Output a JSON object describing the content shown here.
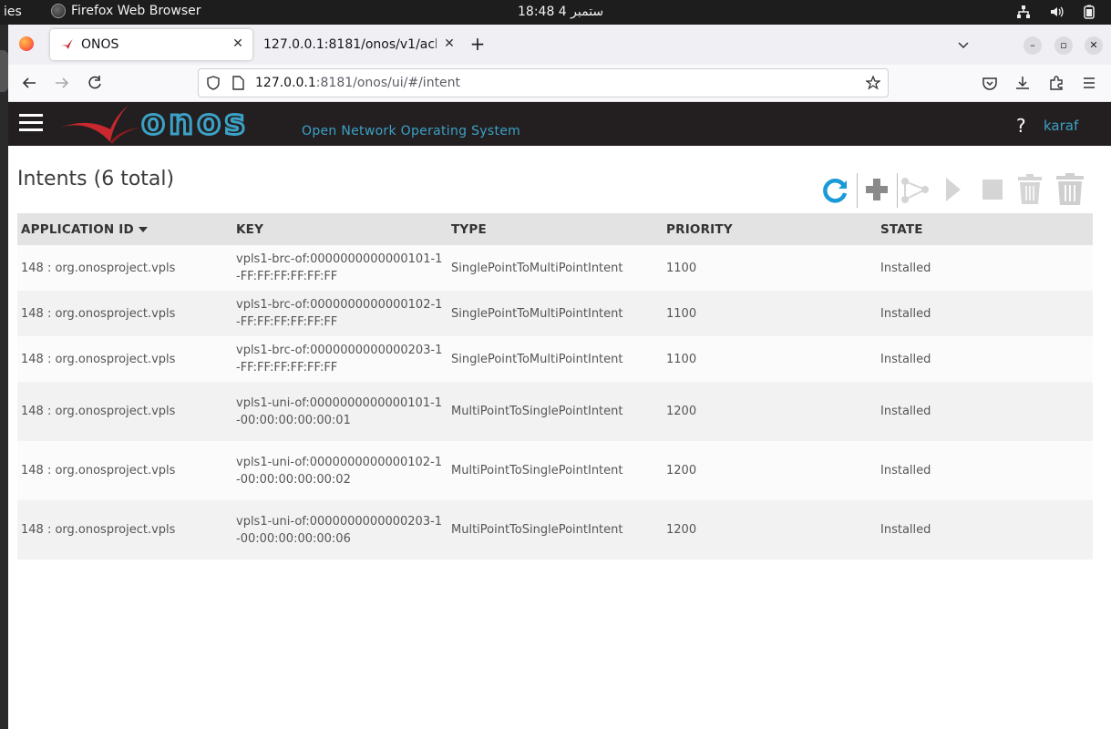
{
  "os": {
    "activities": "ies",
    "app_name": "Firefox Web Browser",
    "clock": "18:48  4 ستمبر"
  },
  "browser": {
    "tabs": [
      {
        "title": "ONOS",
        "active": true
      },
      {
        "title": "127.0.0.1:8181/onos/v1/acl/",
        "active": false
      }
    ],
    "url": {
      "host": "127.0.0.1",
      "rest": ":8181/onos/ui/#/intent"
    },
    "icons": {
      "back": "back-arrow-icon",
      "forward": "forward-arrow-icon",
      "reload": "reload-icon",
      "shield": "tracking-shield-icon",
      "lock": "page-info-icon",
      "bookmark": "bookmark-star-icon",
      "pocket": "pocket-icon",
      "downloads": "download-icon",
      "extensions": "extensions-icon",
      "menu": "hamburger-menu-icon"
    }
  },
  "onos": {
    "brand": "onos",
    "tagline": "Open Network Operating System",
    "help": "?",
    "user": "karaf",
    "accent_color": "#3ba1c6"
  },
  "page": {
    "title": "Intents (6 total)",
    "toolbar": [
      "refresh-icon",
      "add-icon",
      "topology-icon",
      "resubmit-icon",
      "deactivate-icon",
      "purge-icon",
      "purge-all-icon"
    ]
  },
  "table": {
    "headers": {
      "app": "APPLICATION ID",
      "key": "KEY",
      "type": "TYPE",
      "priority": "PRIORITY",
      "state": "STATE"
    },
    "rows": [
      {
        "app": "148 : org.onosproject.vpls",
        "key": "vpls1-brc-of:0000000000000101-1-FF:FF:FF:FF:FF:FF",
        "type": "SinglePointToMultiPointIntent",
        "priority": "1100",
        "state": "Installed"
      },
      {
        "app": "148 : org.onosproject.vpls",
        "key": "vpls1-brc-of:0000000000000102-1-FF:FF:FF:FF:FF:FF",
        "type": "SinglePointToMultiPointIntent",
        "priority": "1100",
        "state": "Installed"
      },
      {
        "app": "148 : org.onosproject.vpls",
        "key": "vpls1-brc-of:0000000000000203-1-FF:FF:FF:FF:FF:FF",
        "type": "SinglePointToMultiPointIntent",
        "priority": "1100",
        "state": "Installed"
      },
      {
        "app": "148 : org.onosproject.vpls",
        "key": "vpls1-uni-of:0000000000000101-1-00:00:00:00:00:01",
        "type": "MultiPointToSinglePointIntent",
        "priority": "1200",
        "state": "Installed"
      },
      {
        "app": "148 : org.onosproject.vpls",
        "key": "vpls1-uni-of:0000000000000102-1-00:00:00:00:00:02",
        "type": "MultiPointToSinglePointIntent",
        "priority": "1200",
        "state": "Installed"
      },
      {
        "app": "148 : org.onosproject.vpls",
        "key": "vpls1-uni-of:0000000000000203-1-00:00:00:00:00:06",
        "type": "MultiPointToSinglePointIntent",
        "priority": "1200",
        "state": "Installed"
      }
    ]
  }
}
